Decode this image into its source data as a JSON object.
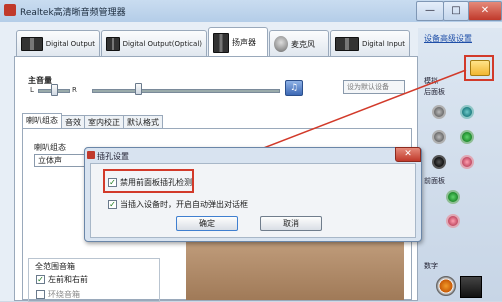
{
  "window": {
    "title": "Realtek高清晰音频管理器",
    "min_label": "—",
    "max_label": "□",
    "close_label": "✕"
  },
  "device_tabs": [
    {
      "label": "Digital Output",
      "icon": "speaker-device-icon"
    },
    {
      "label": "Digital Output(Optical)",
      "icon": "speaker-device-icon"
    },
    {
      "label": "扬声器",
      "icon": "speaker-device-icon"
    },
    {
      "label": "麦克风",
      "icon": "microphone-icon"
    },
    {
      "label": "Digital Input",
      "icon": "speaker-device-icon"
    }
  ],
  "right_panel": {
    "advanced_link": "设备高级设置",
    "analog_label": "模拟",
    "back_panel_label": "后面板",
    "front_panel_label": "前面板",
    "digital_label": "数字"
  },
  "main_volume": {
    "label": "主音量",
    "left_label": "L",
    "right_label": "R",
    "default_device": "设为默认设备"
  },
  "sub_tabs": [
    "喇叭组态",
    "音效",
    "室内校正",
    "默认格式"
  ],
  "speaker_config": {
    "label": "喇叭组态",
    "value": "立体声"
  },
  "full_range": {
    "label": "全范围音箱",
    "options": [
      {
        "label": "左前和右前",
        "checked": true
      },
      {
        "label": "环绕音箱",
        "checked": false
      }
    ]
  },
  "dialog": {
    "title": "插孔设置",
    "close_label": "✕",
    "options": [
      {
        "label": "禁用前面板插孔检测",
        "checked": true
      },
      {
        "label": "当插入设备时，开启自动弹出对话框",
        "checked": true
      }
    ],
    "ok_label": "确定",
    "cancel_label": "取消"
  },
  "colors": {
    "highlight_red": "#d23a2a",
    "link_blue": "#1f4fa8",
    "title_blue": "#c9dcf0"
  }
}
